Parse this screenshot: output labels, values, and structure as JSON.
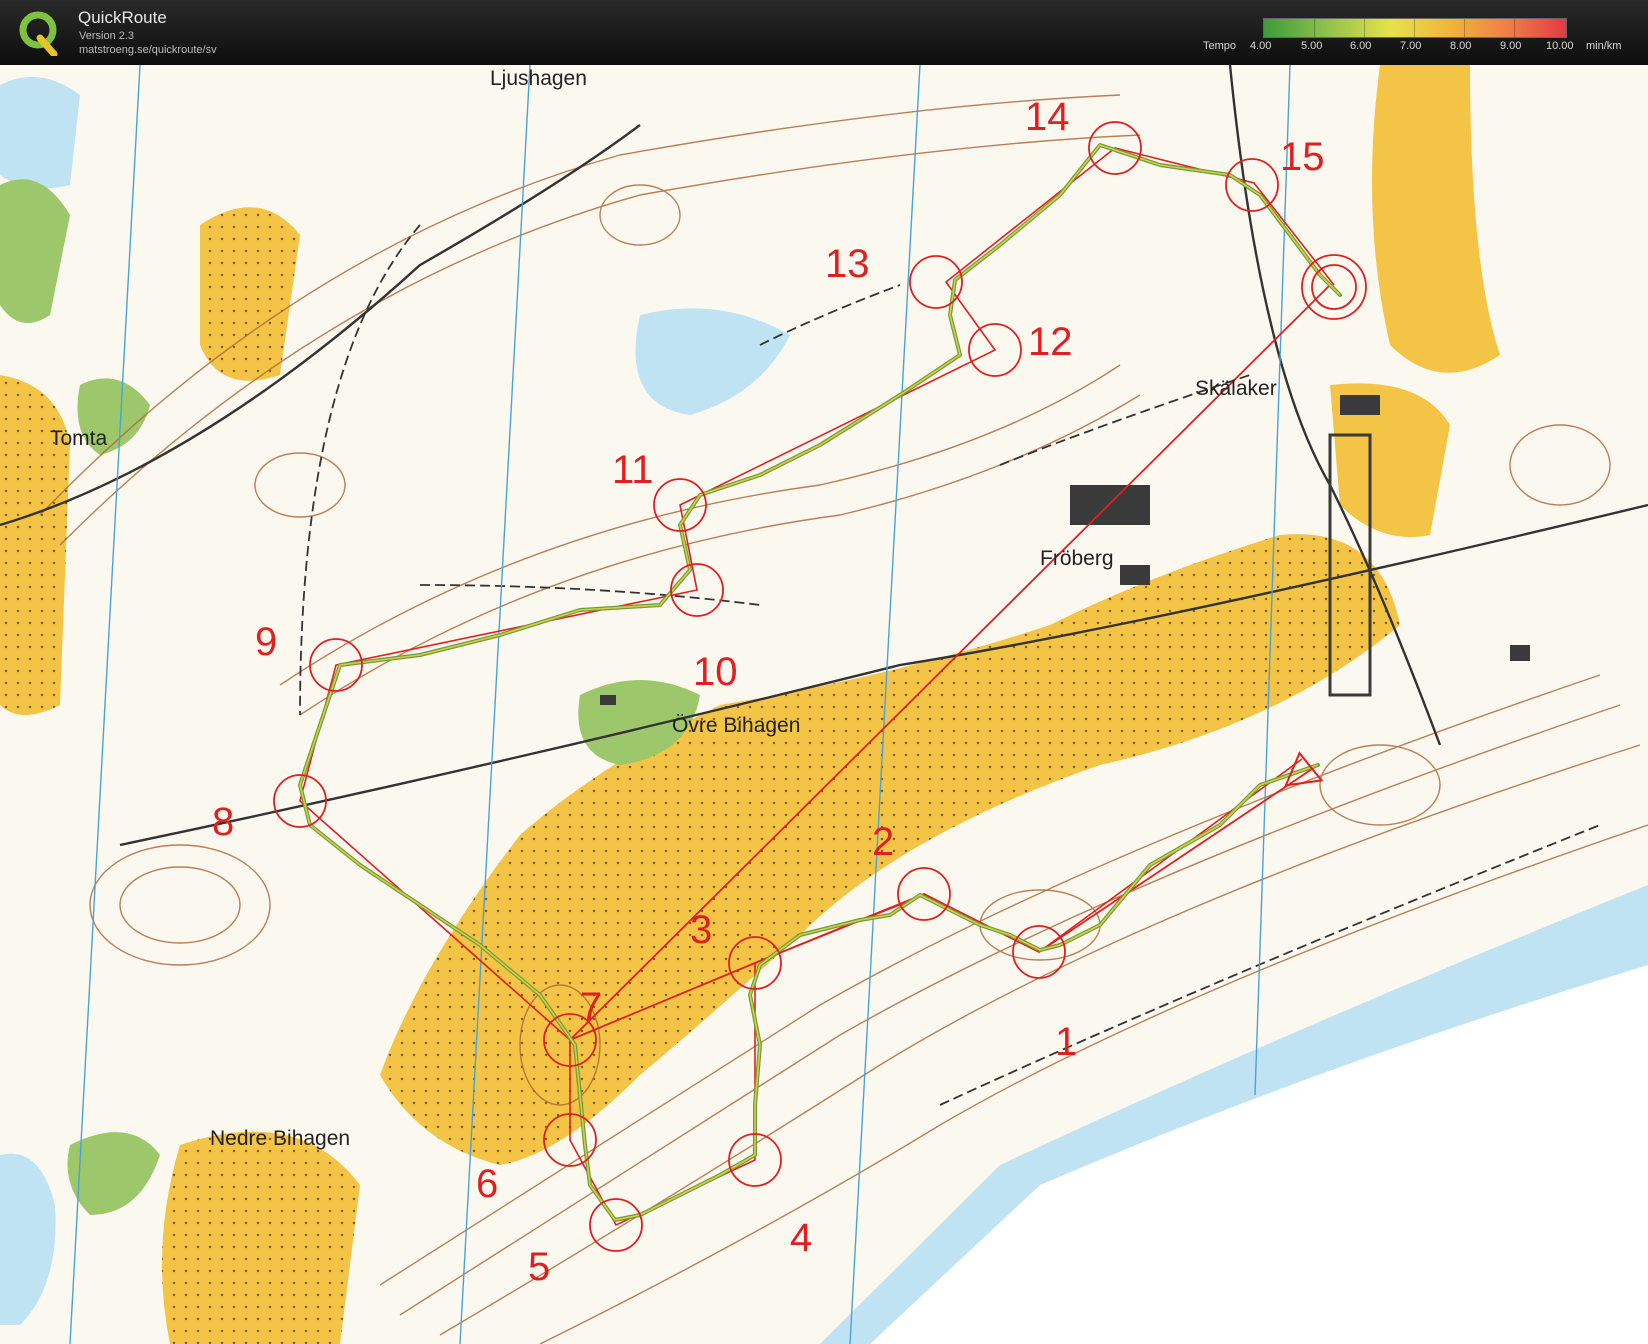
{
  "header": {
    "app_name": "QuickRoute",
    "version": "Version 2.3",
    "url": "matstroeng.se/quickroute/sv",
    "tempo_label": "Tempo",
    "tempo_unit": "min/km",
    "tempo_ticks": [
      "4.00",
      "5.00",
      "6.00",
      "7.00",
      "8.00",
      "9.00",
      "10.00"
    ]
  },
  "map": {
    "place_names": [
      "Ljushagen",
      "Tomta",
      "Skälaker",
      "Fröberg",
      "Övre Bihagen",
      "Nedre Bihagen"
    ],
    "control_numbers": [
      "1",
      "2",
      "3",
      "4",
      "5",
      "6",
      "7",
      "8",
      "9",
      "10",
      "11",
      "12",
      "13",
      "14",
      "15"
    ]
  },
  "colors": {
    "control_red": "#e02020",
    "open_land": "#f3c445",
    "water": "#bfe3f2",
    "contour": "#b06a3a"
  }
}
